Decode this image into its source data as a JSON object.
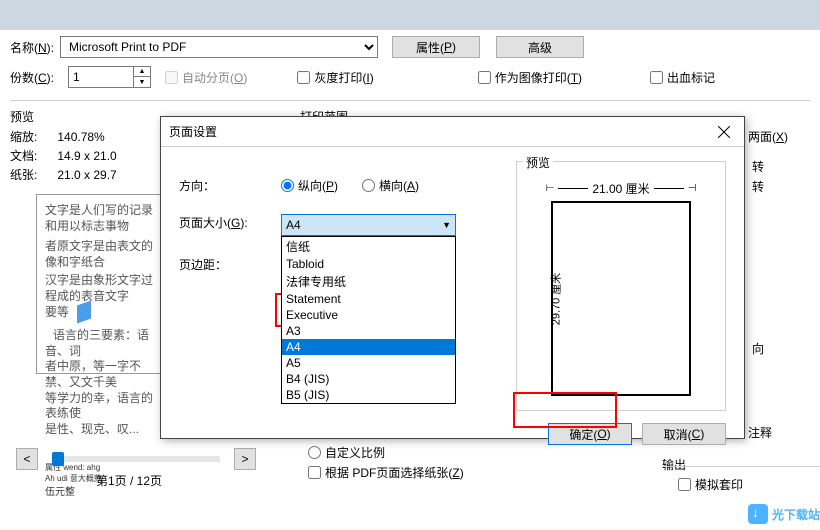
{
  "topLabels": {
    "name": "名称(",
    "nameU": "N",
    "nameEnd": "):",
    "copies": "份数(",
    "copiesU": "C",
    "copiesEnd": "):"
  },
  "printer": "Microsoft Print to PDF",
  "copiesVal": "1",
  "buttons": {
    "props": "属性(",
    "propsU": "P",
    "propsEnd": ")",
    "adv": "高级"
  },
  "checks": {
    "collate": "自动分页(",
    "collateU": "O",
    "collateEnd": ")",
    "gray": "灰度打印(",
    "grayU": "I",
    "grayEnd": ")",
    "asImage": "作为图像打印(",
    "asImageU": "T",
    "asImageEnd": ")",
    "bleed": "出血标记"
  },
  "sectionPreview": "预览",
  "sectionRange": "打印范围",
  "stats": {
    "zoom": "缩放:",
    "zoomVal": "140.78%",
    "doc": "文档:",
    "docVal": "14.9 x 21.0",
    "paper": "纸张:",
    "paperVal": "21.0 x 29.7"
  },
  "thumb": {
    "l1": "文字是人们写的记录和用以标志事物",
    "l2": "者原文字是由表文的像和字纸合",
    "l3": "汉字是由象形文字过程成的表音文字",
    "l4": "要等",
    "l5": "语言的三要素：语音、词",
    "l6": "者中原，等一字不禁、又文千美",
    "l7": "等学力的幸，语言的表练使",
    "l8": "是性、现克、叹...",
    "p1": "属性 wend: ahg",
    "p2": "Ah udi 意大概款",
    "p3": "伍元整"
  },
  "pager": {
    "current": "第1页 / 12页"
  },
  "rightPartial": {
    "duplex": "两面(",
    "duplexU": "X",
    "duplexEnd": ")",
    "shift1": "转",
    "shift2": "转",
    "direction": "向",
    "annot": "注释",
    "output": "输出",
    "simulate": "模拟套印"
  },
  "bottomChecks": {
    "auto": "自定义比例",
    "pdfPaper": "根据 PDF页面选择纸张(",
    "pdfPaperU": "Z",
    "pdfPaperEnd": ")"
  },
  "modal": {
    "title": "页面设置",
    "orientation": "方向：",
    "portrait": "纵向(",
    "portraitU": "P",
    "portraitEnd": ")",
    "landscape": "横向(",
    "landscapeU": "A",
    "landscapeEnd": ")",
    "pageSize": "页面大小(",
    "pageSizeU": "G",
    "pageSizeEnd": "):",
    "margin": "页边距：",
    "selected": "A4",
    "options": {
      "o0": "信纸",
      "o1": "Tabloid",
      "o2": "法律专用纸",
      "o3": "Statement",
      "o4": "Executive",
      "o5": "A3",
      "o6": "A4",
      "o7": "A5",
      "o8": "B4 (JIS)",
      "o9": "B5 (JIS)"
    },
    "preview": "预览",
    "dimW": "21.00 厘米",
    "dimH": "29.70 厘米",
    "ok": "确定(",
    "okU": "O",
    "okEnd": ")",
    "cancel": "取消(",
    "cancelU": "C",
    "cancelEnd": ")"
  },
  "watermark": "光下载站"
}
